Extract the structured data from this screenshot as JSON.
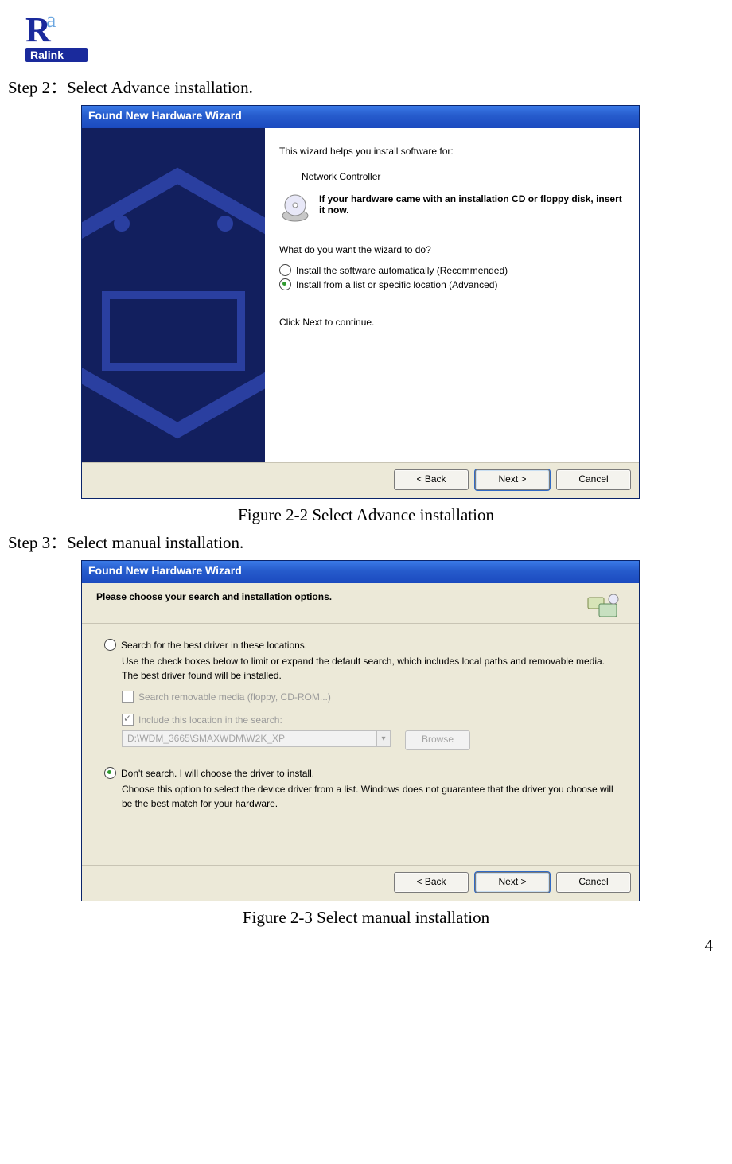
{
  "logo_text": "Ralink",
  "step2_line": "Step 2：Select Advance installation.",
  "step3_line": "Step 3：Select manual installation.",
  "caption1": "Figure 2-2 Select Advance installation",
  "caption2": "Figure 2-3 Select manual installation",
  "page_number": "4",
  "dialog1": {
    "title": "Found New Hardware Wizard",
    "intro": "This wizard helps you install software for:",
    "device": "Network Controller",
    "cd_hint": "If your hardware came with an installation CD or floppy disk, insert it now.",
    "question": "What do you want the wizard to do?",
    "opt_auto": "Install the software automatically (Recommended)",
    "opt_adv": "Install from a list or specific location (Advanced)",
    "continue": "Click Next to continue.",
    "back": "< Back",
    "next": "Next >",
    "cancel": "Cancel"
  },
  "dialog2": {
    "title": "Found New Hardware Wizard",
    "subheader": "Please choose your search and installation options.",
    "opt_search": "Search for the best driver in these locations.",
    "search_help": "Use the check boxes below to limit or expand the default search, which includes local paths and removable media. The best driver found will be installed.",
    "chk_removable": "Search removable media (floppy, CD-ROM...)",
    "chk_include": "Include this location in the search:",
    "path": "D:\\WDM_3665\\SMAXWDM\\W2K_XP",
    "browse": "Browse",
    "opt_dont": "Don't search. I will choose the driver to install.",
    "dont_help": "Choose this option to select the device driver from a list.  Windows does not guarantee that the driver you choose will be the best match for your hardware.",
    "back": "< Back",
    "next": "Next >",
    "cancel": "Cancel"
  }
}
